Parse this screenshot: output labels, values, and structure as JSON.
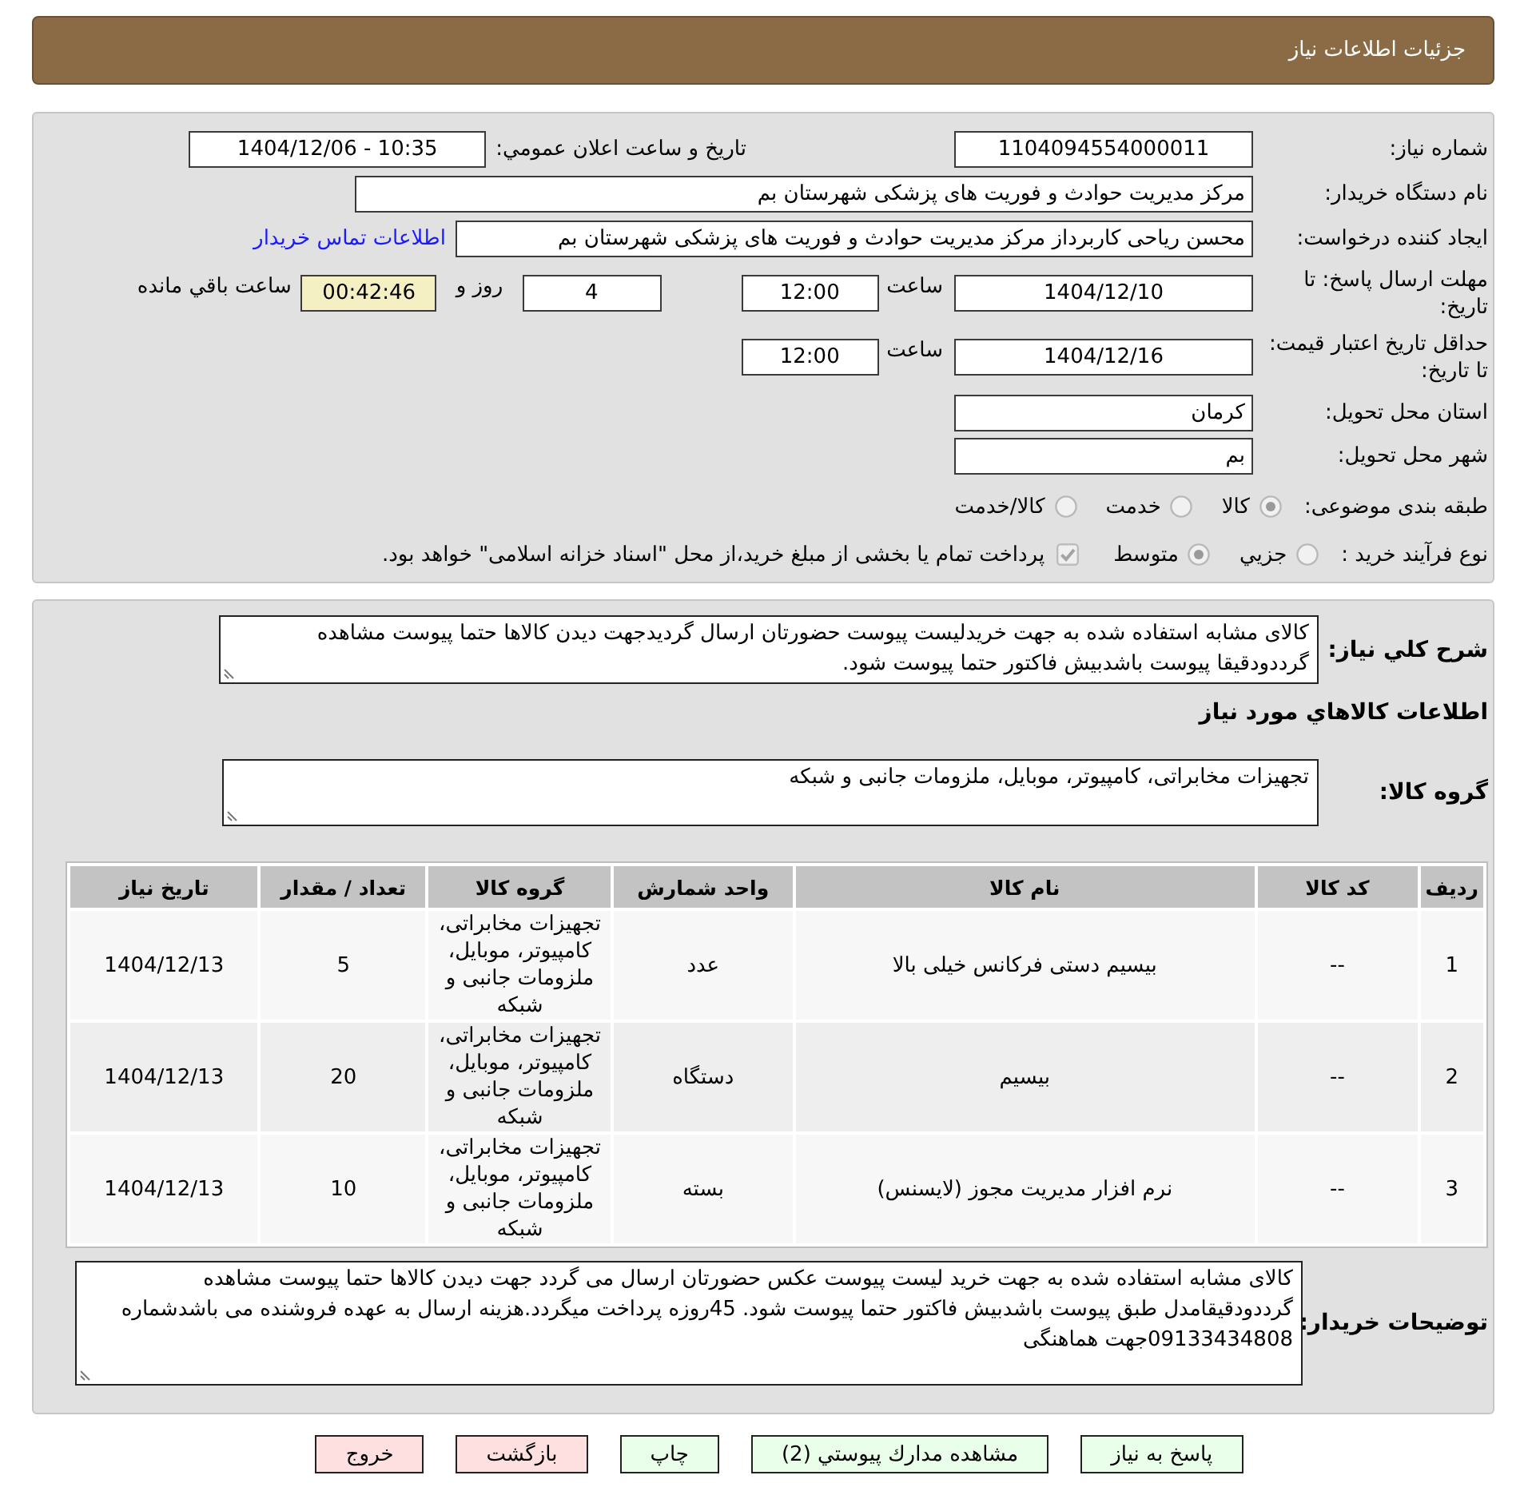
{
  "header": {
    "title": "جزئیات اطلاعات نیاز"
  },
  "details": {
    "need_number": {
      "label": "شماره نیاز:",
      "value": "1104094554000011"
    },
    "announcement": {
      "label": "تاریخ و ساعت اعلان عمومي:",
      "value": "1404/12/06 - 10:35"
    },
    "buyer": {
      "label": "نام دستگاه خریدار:",
      "value": "مرکز مدیریت حوادث و فوریت های پزشکی شهرستان بم"
    },
    "requester": {
      "label": "ایجاد کننده درخواست:",
      "value": "محسن ریاحی کاربرداز مرکز مدیریت حوادث و فوریت های پزشکی شهرستان بم",
      "link": "اطلاعات تماس خریدار"
    },
    "reply_deadline": {
      "label": "مهلت ارسال پاسخ: تا تاریخ:",
      "date": "1404/12/10",
      "time_label": "ساعت",
      "time": "12:00",
      "days": "4",
      "days_label": "روز و",
      "remaining": "00:42:46",
      "remaining_label": "ساعت باقي مانده"
    },
    "price_validity": {
      "label": "حداقل تاریخ اعتبار قیمت: تا تاریخ:",
      "date": "1404/12/16",
      "time_label": "ساعت",
      "time": "12:00"
    },
    "province": {
      "label": "استان محل تحویل:",
      "value": "کرمان"
    },
    "city": {
      "label": "شهر محل تحویل:",
      "value": "بم"
    },
    "category": {
      "label": "طبقه بندی موضوعی:",
      "options": [
        {
          "label": "کالا",
          "selected": true
        },
        {
          "label": "خدمت",
          "selected": false
        },
        {
          "label": "کالا/خدمت",
          "selected": false
        }
      ]
    },
    "process": {
      "label": "نوع فرآیند خرید :",
      "options": [
        {
          "label": "جزيي",
          "selected": false
        },
        {
          "label": "متوسط",
          "selected": true
        }
      ],
      "treasury": {
        "checked": true,
        "text": "پرداخت تمام یا بخشی از مبلغ خرید،از محل \"اسناد خزانه اسلامی\" خواهد بود."
      }
    }
  },
  "requirements": {
    "description": {
      "label": "شرح کلي نياز:",
      "value": "کالای مشابه استفاده شده به جهت خریدلیست پیوست حضورتان ارسال گردیدجهت دیدن کالاها حتما پیوست مشاهده گرددودقیقا پیوست باشدبیش فاکتور حتما پیوست شود."
    },
    "goods_heading": "اطلاعات كالاهاي مورد نياز",
    "goods_group": {
      "label": "گروه کالا:",
      "value": "تجهیزات مخابراتی، کامپیوتر، موبایل، ملزومات جانبی و شبکه"
    },
    "table": {
      "columns": [
        "ردیف",
        "کد کالا",
        "نام کالا",
        "واحد شمارش",
        "گروه کالا",
        "تعداد / مقدار",
        "تاریخ نیاز"
      ],
      "rows": [
        {
          "row_no": "1",
          "code": "--",
          "name": "بیسیم دستی فرکانس خیلی بالا",
          "unit": "عدد",
          "group": "تجهیزات مخابراتی، کامپیوتر، موبایل، ملزومات جانبی و شبکه",
          "quantity": "5",
          "need_date": "1404/12/13"
        },
        {
          "row_no": "2",
          "code": "--",
          "name": "بیسیم",
          "unit": "دستگاه",
          "group": "تجهیزات مخابراتی، کامپیوتر، موبایل، ملزومات جانبی و شبکه",
          "quantity": "20",
          "need_date": "1404/12/13"
        },
        {
          "row_no": "3",
          "code": "--",
          "name": "نرم افزار مدیریت مجوز (لایسنس)",
          "unit": "بسته",
          "group": "تجهیزات مخابراتی، کامپیوتر، موبایل، ملزومات جانبی و شبکه",
          "quantity": "10",
          "need_date": "1404/12/13"
        }
      ]
    },
    "buyer_notes": {
      "label": "توضیحات خریدار:",
      "value": "کالای مشابه استفاده شده به جهت خرید لیست پیوست عکس حضورتان ارسال می گردد جهت دیدن کالاها حتما پیوست مشاهده گرددودقیقامدل طبق پیوست باشدبیش فاکتور حتما پیوست شود. 45روزه پرداخت میگردد.هزینه ارسال به عهده فروشنده می باشدشماره 09133434808جهت هماهنگی"
    }
  },
  "buttons": [
    {
      "label": "پاسخ به نياز",
      "kind": "action"
    },
    {
      "label": "مشاهده مدارك پيوستي (2)",
      "kind": "action"
    },
    {
      "label": "چاپ",
      "kind": "action"
    },
    {
      "label": "بازگشت",
      "kind": "exit"
    },
    {
      "label": "خروج",
      "kind": "exit"
    }
  ]
}
